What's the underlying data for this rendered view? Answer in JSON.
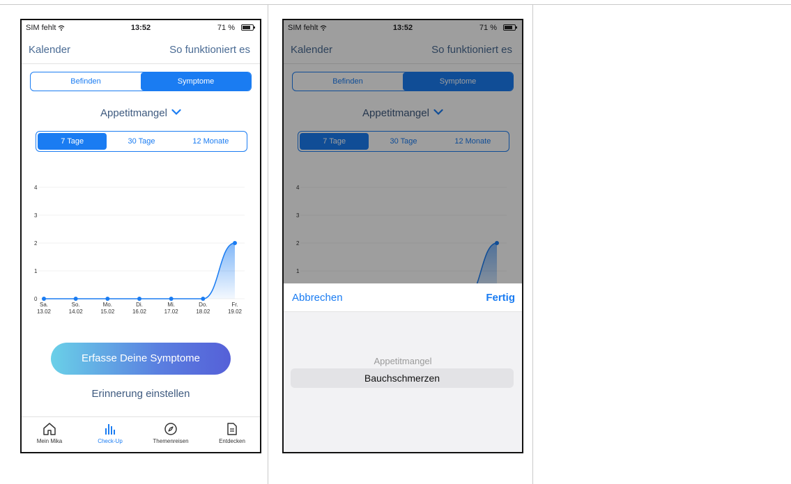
{
  "status_bar": {
    "carrier": "SIM fehlt",
    "time": "13:52",
    "battery": "71 %"
  },
  "nav": {
    "left": "Kalender",
    "right": "So funktioniert es"
  },
  "segment_main": {
    "options": [
      "Befinden",
      "Symptome"
    ],
    "selected": "Symptome"
  },
  "symptom_picker": {
    "label": "Appetitmangel"
  },
  "range_segment": {
    "options": [
      "7 Tage",
      "30 Tage",
      "12 Monate"
    ],
    "selected": "7 Tage"
  },
  "chart_data": {
    "type": "area",
    "categories": [
      "Sa. 13.02",
      "So. 14.02",
      "Mo. 15.02",
      "Di. 16.02",
      "Mi. 17.02",
      "Do. 18.02",
      "Fr. 19.02"
    ],
    "category_lines": [
      [
        "Sa.",
        "13.02"
      ],
      [
        "So.",
        "14.02"
      ],
      [
        "Mo.",
        "15.02"
      ],
      [
        "Di.",
        "16.02"
      ],
      [
        "Mi.",
        "17.02"
      ],
      [
        "Do.",
        "18.02"
      ],
      [
        "Fr.",
        "19.02"
      ]
    ],
    "values": [
      0,
      0,
      0,
      0,
      0,
      0,
      2
    ],
    "yticks": [
      "0",
      "1",
      "2",
      "3",
      "4"
    ],
    "ylim": [
      0,
      4
    ],
    "color": "#1a7cf2"
  },
  "cta": {
    "label": "Erfasse Deine Symptome"
  },
  "reminder": {
    "label": "Erinnerung einstellen"
  },
  "tabbar": {
    "items": [
      {
        "label": "Mein Mika",
        "icon": "home-icon"
      },
      {
        "label": "Check-Up",
        "icon": "bar-chart-icon"
      },
      {
        "label": "Themenreisen",
        "icon": "compass-icon"
      },
      {
        "label": "Entdecken",
        "icon": "document-icon"
      }
    ],
    "active": "Check-Up"
  },
  "picker_sheet": {
    "cancel": "Abbrechen",
    "done": "Fertig",
    "options": [
      "Appetitmangel",
      "Bauchschmerzen"
    ],
    "selected": "Bauchschmerzen"
  },
  "colors": {
    "accent": "#1a7cf2",
    "nav_text": "#4a6b94"
  }
}
